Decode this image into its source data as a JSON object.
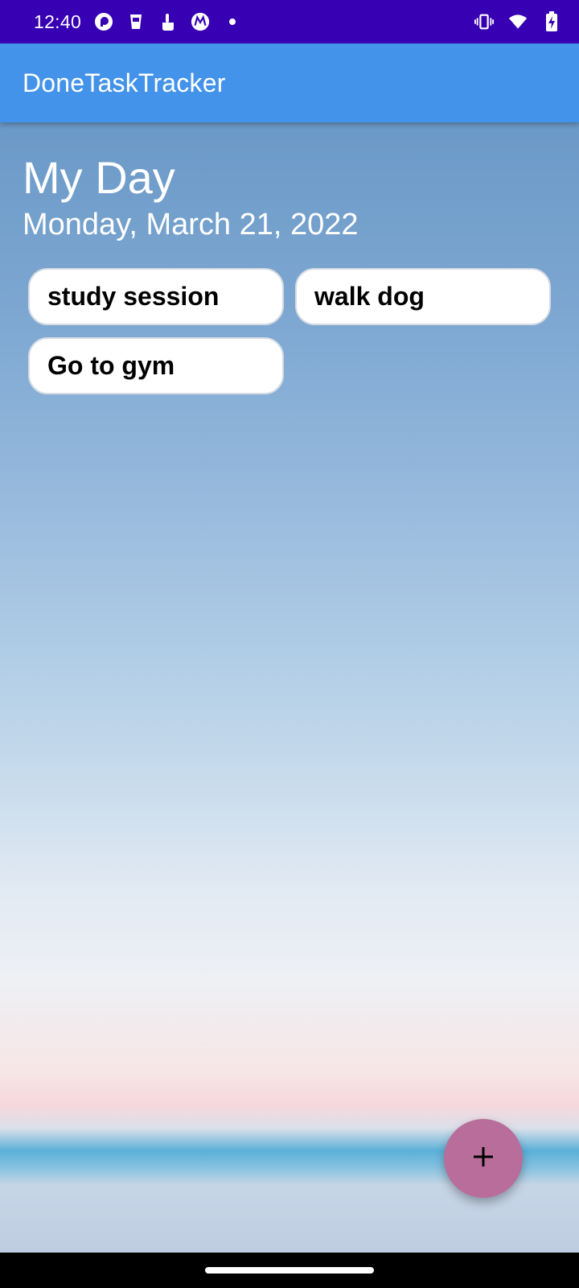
{
  "status_bar": {
    "time": "12:40",
    "left_icons": [
      "pocket-casts-icon",
      "cup-icon",
      "touch-icon",
      "motorola-icon",
      "dot-icon"
    ],
    "right_icons": [
      "vibrate-icon",
      "wifi-icon",
      "battery-charging-icon"
    ]
  },
  "app_bar": {
    "title": "DoneTaskTracker",
    "color": "#4293e9"
  },
  "main": {
    "title": "My Day",
    "date": "Monday, March 21, 2022",
    "tasks": [
      {
        "label": "study session"
      },
      {
        "label": "walk dog"
      },
      {
        "label": "Go to gym"
      }
    ]
  },
  "fab": {
    "icon": "plus-icon",
    "color": "#b86d9a"
  },
  "status_bar_color": "#3700b3"
}
